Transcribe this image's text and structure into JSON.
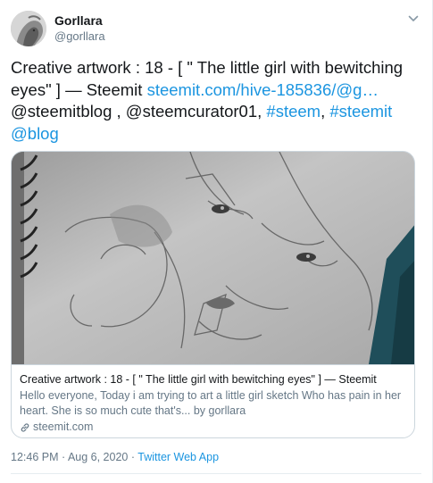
{
  "author": {
    "display_name": "Gorllara",
    "handle": "@gorllara"
  },
  "tweet": {
    "text_main": "Creative artwork : 18 - [ \" The little girl with bewitching eyes\" ] — Steemit ",
    "link_text": "steemit.com/hive-185836/@g…",
    "mentions_line": "@steemitblog , @steemcurator01, ",
    "hashtag_1": "#steem",
    "sep": ", ",
    "hashtag_2": "#steemit",
    "hashtag_3": "@blog"
  },
  "card": {
    "title": "Creative artwork : 18 - [ \" The little girl with bewitching eyes\" ] — Steemit",
    "description": "Hello everyone, Today i am trying to art a little girl sketch Who has pain in her heart. She is so much cute that's... by gorllara",
    "domain": "steemit.com",
    "icon": "link-icon"
  },
  "meta": {
    "time": "12:46 PM",
    "dot": " · ",
    "date": "Aug 6, 2020",
    "dot2": " · ",
    "source": "Twitter Web App"
  },
  "colors": {
    "link": "#1b95e0",
    "text": "#14171a",
    "muted": "#657786",
    "border": "#ccd6dd"
  }
}
